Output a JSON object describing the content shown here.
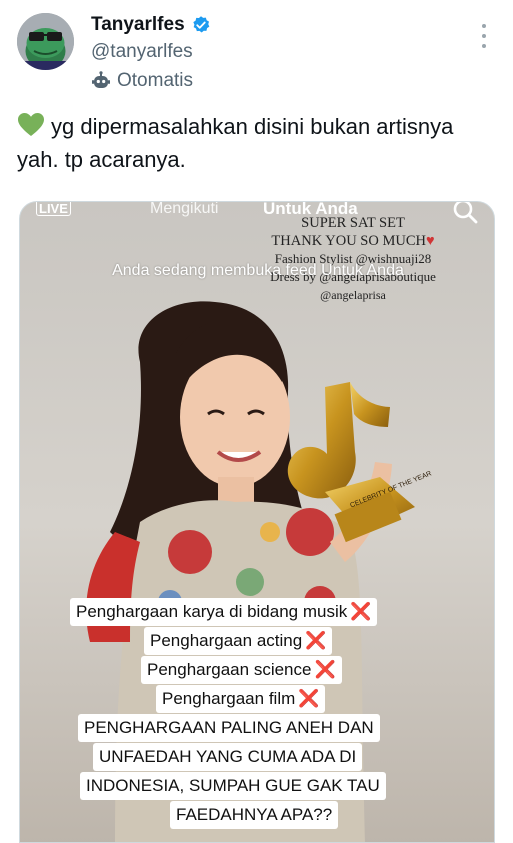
{
  "author": {
    "display_name": "Tanyarlfes",
    "handle": "@tanyarlfes",
    "automated_label": "Otomatis",
    "verified_color": "#1d9bf0"
  },
  "tweet": {
    "text": "yg dipermasalahkan disini bukan artisnya yah. tp acaranya."
  },
  "tiktok": {
    "live_label": "LIVE",
    "tab_following": "Mengikuti",
    "tab_for_you": "Untuk Anda",
    "banner": "Anda sedang membuka feed Untuk Anda"
  },
  "caption": {
    "line1": "SUPER SAT SET",
    "line2": "THANK YOU SO MUCH",
    "line3": "Fashion Stylist @wishnuaji28",
    "line4": "Dress by @angelaprisaboutique",
    "line5": "@angelaprisa"
  },
  "overlay_texts": {
    "item1": "Penghargaan karya di bidang musik",
    "item2": "Penghargaan acting",
    "item3": "Penghargaan science",
    "item4": "Penghargaan film",
    "paragraph_line1": "PENGHARGAAN PALING ANEH DAN",
    "paragraph_line2": "UNFAEDAH YANG CUMA ADA DI",
    "paragraph_line3": "INDONESIA, SUMPAH GUE GAK TAU",
    "paragraph_line4": "FAEDAHNYA APA??",
    "x_mark": "❌"
  },
  "trophy": {
    "plaque_text": "CELEBRITY OF THE YEAR"
  }
}
